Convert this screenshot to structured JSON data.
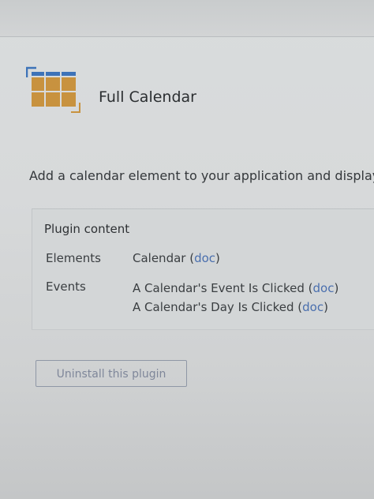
{
  "plugin": {
    "title": "Full Calendar",
    "description": "Add a calendar element to your application and display eve"
  },
  "content_panel": {
    "heading": "Plugin content",
    "rows": [
      {
        "label": "Elements",
        "items": [
          {
            "text": "Calendar (",
            "link": "doc",
            "suffix": ")"
          }
        ]
      },
      {
        "label": "Events",
        "items": [
          {
            "text": "A Calendar's Event Is Clicked (",
            "link": "doc",
            "suffix": ")"
          },
          {
            "text": "A Calendar's Day Is Clicked (",
            "link": "doc",
            "suffix": ")"
          }
        ]
      }
    ]
  },
  "actions": {
    "uninstall_label": "Uninstall this plugin"
  },
  "colors": {
    "link": "#4a6fae",
    "icon_blue": "#3d73b8",
    "icon_tan": "#c8923f",
    "button_border": "#8f97a6"
  },
  "icons": {
    "plugin_icon": "calendar-icon"
  }
}
